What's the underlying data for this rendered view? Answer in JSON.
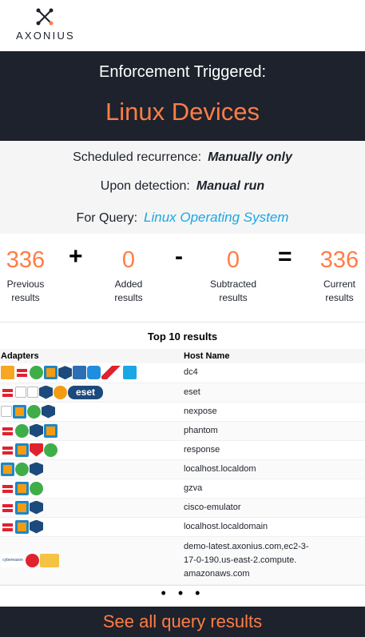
{
  "brand": {
    "name": "AXONIUS",
    "logo_icon": "axonius-x-logo-icon"
  },
  "hero": {
    "title": "Enforcement Triggered:",
    "name": "Linux Devices"
  },
  "details": {
    "recurrence_label": "Scheduled recurrence:",
    "recurrence_value": "Manually only",
    "detection_label": "Upon detection:",
    "detection_value": "Manual run",
    "query_label": "For Query:",
    "query_value": "Linux Operating System"
  },
  "counts": {
    "previous": {
      "value": "336",
      "label_1": "Previous",
      "label_2": "results"
    },
    "added": {
      "value": "0",
      "label_1": "Added",
      "label_2": "results"
    },
    "subtracted": {
      "value": "0",
      "label_1": "Subtracted",
      "label_2": "results"
    },
    "current": {
      "value": "336",
      "label_1": "Current",
      "label_2": "results"
    },
    "op_plus": "+",
    "op_minus": "-",
    "op_equals": "="
  },
  "results": {
    "title": "Top 10 results",
    "col_adapters": "Adapters",
    "col_host": "Host Name",
    "rows": [
      {
        "adapters": [
          "orange",
          "fortinet",
          "green",
          "blue-sq",
          "navy",
          "blue-d",
          "blue-s",
          "crowd",
          "win"
        ],
        "host": "dc4"
      },
      {
        "adapters": [
          "fortinet",
          "broken",
          "broken",
          "navy",
          "carbon",
          "eset"
        ],
        "host": "eset"
      },
      {
        "adapters": [
          "broken",
          "blue-sq",
          "green",
          "navy"
        ],
        "host": "nexpose"
      },
      {
        "adapters": [
          "fortinet",
          "green",
          "navy",
          "blue-sq"
        ],
        "host": "phantom"
      },
      {
        "adapters": [
          "fortinet",
          "blue-sq",
          "redshield",
          "green"
        ],
        "host": "response"
      },
      {
        "adapters": [
          "blue-sq",
          "green",
          "navy"
        ],
        "host": "localhost.localdom"
      },
      {
        "adapters": [
          "fortinet",
          "blue-sq",
          "green"
        ],
        "host": "gzva"
      },
      {
        "adapters": [
          "fortinet",
          "blue-sq",
          "navy"
        ],
        "host": "cisco-emulator"
      },
      {
        "adapters": [
          "fortinet",
          "blue-sq",
          "navy"
        ],
        "host": "localhost.localdomain"
      },
      {
        "adapters": [
          "cyber",
          "trend",
          "cubes"
        ],
        "host_lines": [
          "demo-latest.axonius.com,ec2-3-",
          "17-0-190.us-east-2.compute.",
          "amazonaws.com"
        ]
      }
    ],
    "eset_text": "eset",
    "cyber_text": "cybereason"
  },
  "more": "• • •",
  "footer": {
    "link": "See all query results"
  }
}
